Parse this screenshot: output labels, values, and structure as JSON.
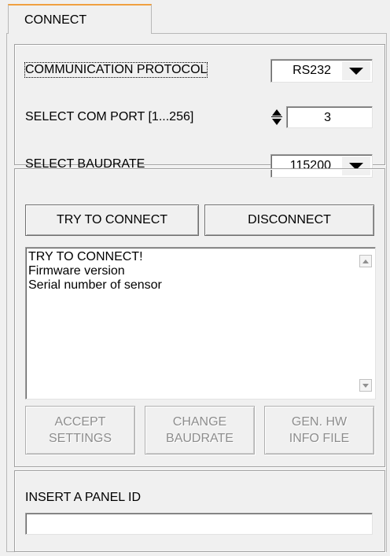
{
  "tab": {
    "label": "CONNECT"
  },
  "communication": {
    "protocol_label": "COMMUNICATION PROTOCOL",
    "protocol_value": "RS232",
    "com_port_label": "SELECT COM PORT [1...256]",
    "com_port_value": "3",
    "baudrate_label": "SELECT BAUDRATE",
    "baudrate_value": "115200"
  },
  "connection": {
    "try_connect_label": "TRY TO CONNECT",
    "disconnect_label": "DISCONNECT",
    "log_lines": [
      "TRY TO CONNECT!",
      "Firmware version",
      "Serial number of sensor"
    ],
    "accept_settings": [
      "ACCEPT",
      "SETTINGS"
    ],
    "change_baudrate": [
      "CHANGE",
      "BAUDRATE"
    ],
    "gen_hw_info": [
      "GEN. HW",
      "INFO FILE"
    ]
  },
  "panel": {
    "label": "INSERT A PANEL ID",
    "value": ""
  },
  "icons": {
    "dropdown": "chevron-down-icon",
    "spinner": "spinner-arrows-icon",
    "scroll_up": "scroll-up-icon",
    "scroll_down": "scroll-down-icon"
  },
  "colors": {
    "tab_accent": "#f0a040",
    "background": "#f0f0f0",
    "disabled_text": "#8d8d8d"
  }
}
